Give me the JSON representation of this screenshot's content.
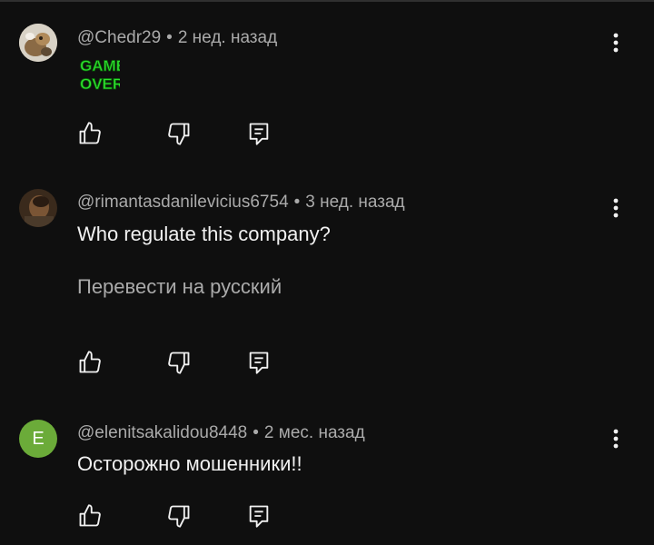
{
  "comments": [
    {
      "author": "@Chedr29",
      "separator": "•",
      "time": "2 нед. назад",
      "sticker_text_line1": "GAME",
      "sticker_text_line2": "OVER",
      "actions": [
        "like-icon",
        "dislike-icon",
        "reply-icon"
      ]
    },
    {
      "author": "@rimantasdanilevicius6754",
      "separator": "•",
      "time": "3 нед. назад",
      "text": "Who regulate this company?",
      "translate_link": "Перевести на русский",
      "actions": [
        "like-icon",
        "dislike-icon",
        "reply-icon"
      ]
    },
    {
      "author": "@elenitsakalidou8448",
      "separator": "•",
      "time": "2 мес. назад",
      "avatar_letter": "E",
      "text": "Осторожно мошенники!!",
      "actions": [
        "like-icon",
        "dislike-icon",
        "reply-icon"
      ]
    }
  ],
  "colors": {
    "background": "#0f0f0f",
    "meta_text": "#aaaaaa",
    "body_text": "#f1f1f1",
    "avatar_e": "#6bab39",
    "sticker_green": "#2fe02f"
  }
}
